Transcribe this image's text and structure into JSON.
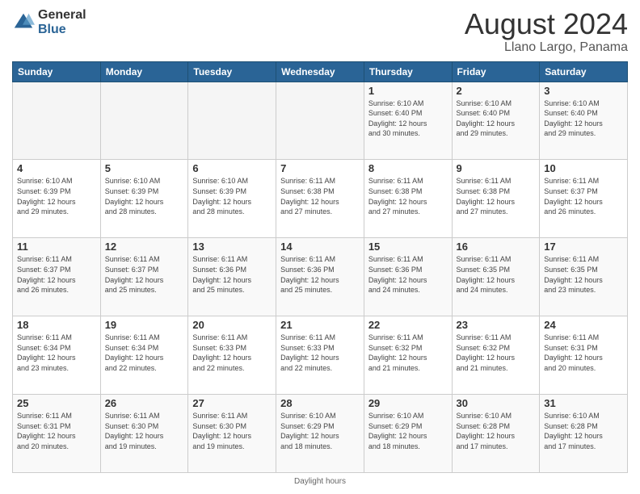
{
  "header": {
    "logo_general": "General",
    "logo_blue": "Blue",
    "title": "August 2024",
    "location": "Llano Largo, Panama"
  },
  "footer": {
    "text": "Daylight hours"
  },
  "days_of_week": [
    "Sunday",
    "Monday",
    "Tuesday",
    "Wednesday",
    "Thursday",
    "Friday",
    "Saturday"
  ],
  "weeks": [
    [
      {
        "num": "",
        "info": ""
      },
      {
        "num": "",
        "info": ""
      },
      {
        "num": "",
        "info": ""
      },
      {
        "num": "",
        "info": ""
      },
      {
        "num": "1",
        "info": "Sunrise: 6:10 AM\nSunset: 6:40 PM\nDaylight: 12 hours\nand 30 minutes."
      },
      {
        "num": "2",
        "info": "Sunrise: 6:10 AM\nSunset: 6:40 PM\nDaylight: 12 hours\nand 29 minutes."
      },
      {
        "num": "3",
        "info": "Sunrise: 6:10 AM\nSunset: 6:40 PM\nDaylight: 12 hours\nand 29 minutes."
      }
    ],
    [
      {
        "num": "4",
        "info": "Sunrise: 6:10 AM\nSunset: 6:39 PM\nDaylight: 12 hours\nand 29 minutes."
      },
      {
        "num": "5",
        "info": "Sunrise: 6:10 AM\nSunset: 6:39 PM\nDaylight: 12 hours\nand 28 minutes."
      },
      {
        "num": "6",
        "info": "Sunrise: 6:10 AM\nSunset: 6:39 PM\nDaylight: 12 hours\nand 28 minutes."
      },
      {
        "num": "7",
        "info": "Sunrise: 6:11 AM\nSunset: 6:38 PM\nDaylight: 12 hours\nand 27 minutes."
      },
      {
        "num": "8",
        "info": "Sunrise: 6:11 AM\nSunset: 6:38 PM\nDaylight: 12 hours\nand 27 minutes."
      },
      {
        "num": "9",
        "info": "Sunrise: 6:11 AM\nSunset: 6:38 PM\nDaylight: 12 hours\nand 27 minutes."
      },
      {
        "num": "10",
        "info": "Sunrise: 6:11 AM\nSunset: 6:37 PM\nDaylight: 12 hours\nand 26 minutes."
      }
    ],
    [
      {
        "num": "11",
        "info": "Sunrise: 6:11 AM\nSunset: 6:37 PM\nDaylight: 12 hours\nand 26 minutes."
      },
      {
        "num": "12",
        "info": "Sunrise: 6:11 AM\nSunset: 6:37 PM\nDaylight: 12 hours\nand 25 minutes."
      },
      {
        "num": "13",
        "info": "Sunrise: 6:11 AM\nSunset: 6:36 PM\nDaylight: 12 hours\nand 25 minutes."
      },
      {
        "num": "14",
        "info": "Sunrise: 6:11 AM\nSunset: 6:36 PM\nDaylight: 12 hours\nand 25 minutes."
      },
      {
        "num": "15",
        "info": "Sunrise: 6:11 AM\nSunset: 6:36 PM\nDaylight: 12 hours\nand 24 minutes."
      },
      {
        "num": "16",
        "info": "Sunrise: 6:11 AM\nSunset: 6:35 PM\nDaylight: 12 hours\nand 24 minutes."
      },
      {
        "num": "17",
        "info": "Sunrise: 6:11 AM\nSunset: 6:35 PM\nDaylight: 12 hours\nand 23 minutes."
      }
    ],
    [
      {
        "num": "18",
        "info": "Sunrise: 6:11 AM\nSunset: 6:34 PM\nDaylight: 12 hours\nand 23 minutes."
      },
      {
        "num": "19",
        "info": "Sunrise: 6:11 AM\nSunset: 6:34 PM\nDaylight: 12 hours\nand 22 minutes."
      },
      {
        "num": "20",
        "info": "Sunrise: 6:11 AM\nSunset: 6:33 PM\nDaylight: 12 hours\nand 22 minutes."
      },
      {
        "num": "21",
        "info": "Sunrise: 6:11 AM\nSunset: 6:33 PM\nDaylight: 12 hours\nand 22 minutes."
      },
      {
        "num": "22",
        "info": "Sunrise: 6:11 AM\nSunset: 6:32 PM\nDaylight: 12 hours\nand 21 minutes."
      },
      {
        "num": "23",
        "info": "Sunrise: 6:11 AM\nSunset: 6:32 PM\nDaylight: 12 hours\nand 21 minutes."
      },
      {
        "num": "24",
        "info": "Sunrise: 6:11 AM\nSunset: 6:31 PM\nDaylight: 12 hours\nand 20 minutes."
      }
    ],
    [
      {
        "num": "25",
        "info": "Sunrise: 6:11 AM\nSunset: 6:31 PM\nDaylight: 12 hours\nand 20 minutes."
      },
      {
        "num": "26",
        "info": "Sunrise: 6:11 AM\nSunset: 6:30 PM\nDaylight: 12 hours\nand 19 minutes."
      },
      {
        "num": "27",
        "info": "Sunrise: 6:11 AM\nSunset: 6:30 PM\nDaylight: 12 hours\nand 19 minutes."
      },
      {
        "num": "28",
        "info": "Sunrise: 6:10 AM\nSunset: 6:29 PM\nDaylight: 12 hours\nand 18 minutes."
      },
      {
        "num": "29",
        "info": "Sunrise: 6:10 AM\nSunset: 6:29 PM\nDaylight: 12 hours\nand 18 minutes."
      },
      {
        "num": "30",
        "info": "Sunrise: 6:10 AM\nSunset: 6:28 PM\nDaylight: 12 hours\nand 17 minutes."
      },
      {
        "num": "31",
        "info": "Sunrise: 6:10 AM\nSunset: 6:28 PM\nDaylight: 12 hours\nand 17 minutes."
      }
    ]
  ]
}
